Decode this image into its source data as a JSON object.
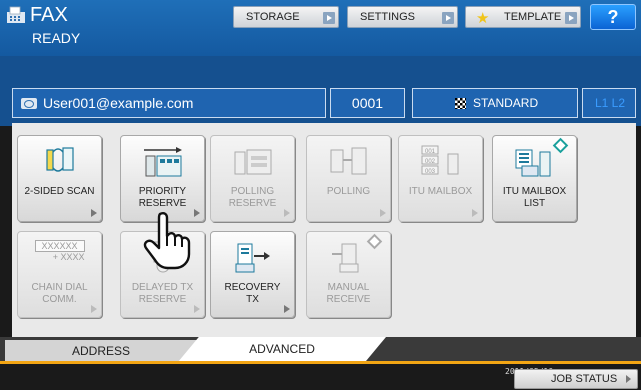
{
  "header": {
    "title": "FAX",
    "status": "READY",
    "buttons": {
      "storage": "STORAGE",
      "settings": "SETTINGS",
      "template": "TEMPLATE",
      "help": "?"
    }
  },
  "recipient": {
    "email": "User001@example.com",
    "count": "0001",
    "quality": "STANDARD",
    "line_indicator": "L1 L2"
  },
  "functions": [
    {
      "label_1": "2-SIDED SCAN",
      "label_2": "",
      "enabled": true,
      "icon": "two-sided-scan-icon"
    },
    {
      "label_1": "PRIORITY",
      "label_2": "RESERVE",
      "enabled": true,
      "icon": "priority-reserve-icon"
    },
    {
      "label_1": "POLLING",
      "label_2": "RESERVE",
      "enabled": false,
      "icon": "polling-reserve-icon"
    },
    {
      "label_1": "POLLING",
      "label_2": "",
      "enabled": false,
      "icon": "polling-icon"
    },
    {
      "label_1": "ITU MAILBOX",
      "label_2": "",
      "enabled": false,
      "icon": "itu-mailbox-icon"
    },
    {
      "label_1": "ITU MAILBOX",
      "label_2": "LIST",
      "enabled": true,
      "icon": "itu-mailbox-list-icon"
    },
    {
      "label_1": "CHAIN DIAL",
      "label_2": "COMM.",
      "enabled": false,
      "icon": "chain-dial-icon",
      "icon_text_1": "XXXXXX",
      "icon_text_2": "+ XXXX"
    },
    {
      "label_1": "DELAYED TX",
      "label_2": "RESERVE",
      "enabled": false,
      "icon": "delayed-tx-icon"
    },
    {
      "label_1": "RECOVERY",
      "label_2": "TX",
      "enabled": true,
      "icon": "recovery-tx-icon"
    },
    {
      "label_1": "MANUAL",
      "label_2": "RECEIVE",
      "enabled": false,
      "icon": "manual-receive-icon"
    }
  ],
  "tabs": {
    "address": "ADDRESS",
    "advanced": "ADVANCED"
  },
  "footer": {
    "date": "2011/05/10",
    "time": "09:55",
    "job_status": "JOB STATUS"
  },
  "colors": {
    "header_blue": "#1f6fb8",
    "tab_accent": "#f2a514",
    "help_blue": "#0b63d4"
  }
}
